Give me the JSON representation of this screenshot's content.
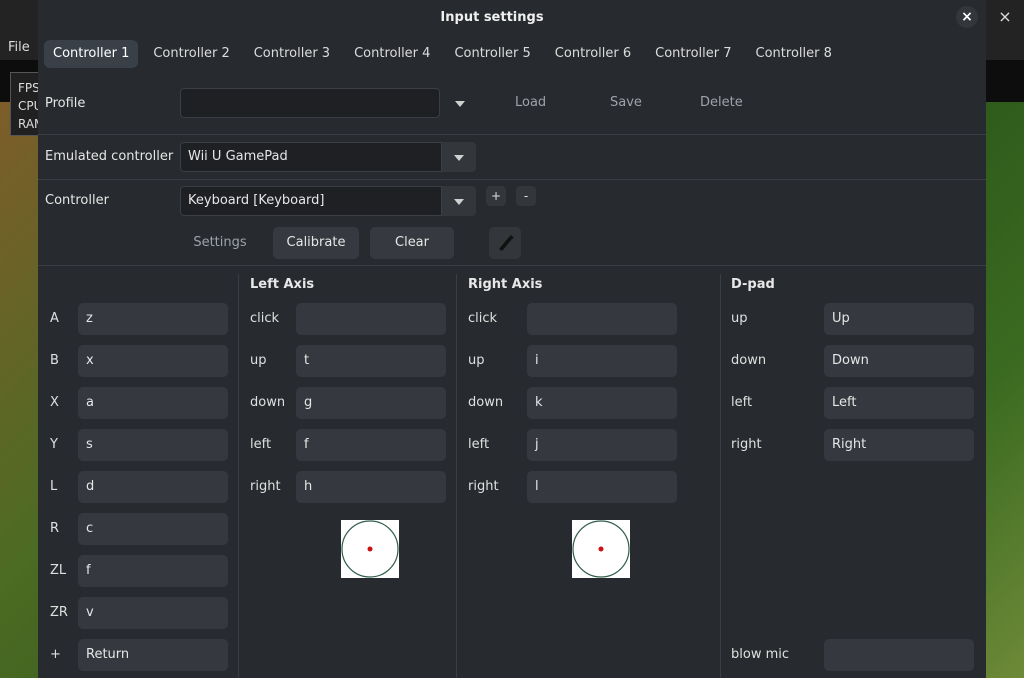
{
  "background": {
    "menu_file": "File",
    "stats_lines": [
      "FPS",
      "CPU",
      "RAM"
    ],
    "close_glyph": "×"
  },
  "dialog": {
    "title": "Input settings",
    "close_glyph": "×"
  },
  "tabs": [
    {
      "label": "Controller 1",
      "active": true
    },
    {
      "label": "Controller 2"
    },
    {
      "label": "Controller 3"
    },
    {
      "label": "Controller 4"
    },
    {
      "label": "Controller 5"
    },
    {
      "label": "Controller 6"
    },
    {
      "label": "Controller 7"
    },
    {
      "label": "Controller 8"
    }
  ],
  "profile": {
    "label": "Profile",
    "value": "",
    "load": "Load",
    "save": "Save",
    "delete": "Delete"
  },
  "emulated": {
    "label": "Emulated controller",
    "value": "Wii U GamePad"
  },
  "controller": {
    "label": "Controller",
    "value": "Keyboard [Keyboard]",
    "add": "+",
    "remove": "-",
    "settings": "Settings",
    "calibrate": "Calibrate",
    "clear": "Clear",
    "icon": "wand-icon"
  },
  "buttons": [
    {
      "label": "A",
      "value": "z"
    },
    {
      "label": "B",
      "value": "x"
    },
    {
      "label": "X",
      "value": "a"
    },
    {
      "label": "Y",
      "value": "s"
    },
    {
      "label": "L",
      "value": "d"
    },
    {
      "label": "R",
      "value": "c"
    },
    {
      "label": "ZL",
      "value": "f"
    },
    {
      "label": "ZR",
      "value": "v"
    },
    {
      "label": "+",
      "value": "Return"
    }
  ],
  "left_axis": {
    "title": "Left Axis",
    "rows": [
      {
        "label": "click",
        "value": ""
      },
      {
        "label": "up",
        "value": "t"
      },
      {
        "label": "down",
        "value": "g"
      },
      {
        "label": "left",
        "value": "f"
      },
      {
        "label": "right",
        "value": "h"
      }
    ]
  },
  "right_axis": {
    "title": "Right Axis",
    "rows": [
      {
        "label": "click",
        "value": ""
      },
      {
        "label": "up",
        "value": "i"
      },
      {
        "label": "down",
        "value": "k"
      },
      {
        "label": "left",
        "value": "j"
      },
      {
        "label": "right",
        "value": "l"
      }
    ]
  },
  "dpad": {
    "title": "D-pad",
    "rows": [
      {
        "label": "up",
        "value": "Up"
      },
      {
        "label": "down",
        "value": "Down"
      },
      {
        "label": "left",
        "value": "Left"
      },
      {
        "label": "right",
        "value": "Right"
      }
    ],
    "blow_mic_label": "blow mic",
    "blow_mic_value": ""
  },
  "colors": {
    "dialog_bg": "#272a2e",
    "field_bg": "#35393f",
    "stick_ring": "#2f5d4a",
    "stick_dot": "#cc1111"
  }
}
